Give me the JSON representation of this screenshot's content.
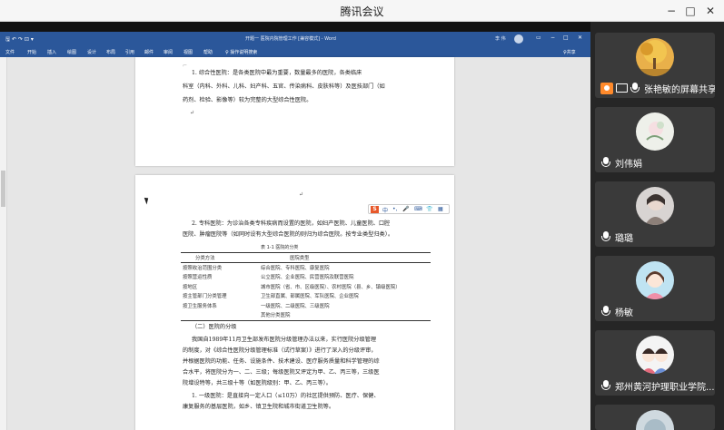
{
  "window": {
    "title": "腾讯会议",
    "controls": [
      "−",
      "□",
      "✕"
    ]
  },
  "word": {
    "doc_title": "开题一 医院内院管理工作 [兼容模式] - Word",
    "user": "李 伟",
    "quick_access": "🖫 ↶ ↷ ⊡ ▾",
    "menu": [
      "文件",
      "开始",
      "插入",
      "绘图",
      "设计",
      "布局",
      "引用",
      "邮件",
      "审阅",
      "视图",
      "帮助",
      "♀ 操作说明搜索",
      "♀共享"
    ],
    "page1": [
      "1. 综合性医院：是各类医院中最为重要，数量最多的医院，各类临床",
      "科室（内科、外科、儿科、妇产科、五官、传染病科、皮肤科等）及医技部门（如",
      "药剂、检验、影像等）较为完整的大型综合性医院。"
    ],
    "page2": {
      "intro": [
        "2. 专科医院：为诊治各类专科疾病而设置的医院，如妇产医院、儿童医院、口腔",
        "医院、肿瘤医院等（如同时设有大型综合医院的则归为综合医院。按专业类型归类）。"
      ],
      "table_caption": "表 1-1 医院的分类",
      "table_headers": [
        "分类方法",
        "医院类型"
      ],
      "table_rows": [
        [
          "按照收治范围分类",
          "综合医院、专科医院、康复医院"
        ],
        [
          "按照营运性质",
          "公立医院、企业医院、民营医院及联营医院"
        ],
        [
          "按地区",
          "城市医院（省、市、区级医院）、农村医院（县、乡、镇级医院）"
        ],
        [
          "按主管部门分类管理",
          "卫生部直属、部属医院、军队医院、企业医院"
        ],
        [
          "按卫生服务体系",
          "一级医院、二级医院、三级医院"
        ],
        [
          "",
          "其他分类医院"
        ]
      ],
      "section": "（二）医院的分级",
      "body": [
        "我国自1989年11月卫生部发布医院分级管理办法以来，实行医院分级管理",
        "的制度，对《综合性医院分级管理标准（试行草案）》进行了深入的分级评审，",
        "并根据医院的功能、任务、设施条件、技术建设、医疗服务质量和科学管理的综",
        "合水平，将医院分为一、二、三级；每级医院又评定为甲、乙、丙三等，三级医",
        "院增设特等，共三级十等（如医院级别：甲、乙、丙三等）。",
        "1. 一级医院：是直接向一定人口（≤10万）的社区提供预防、医疗、保健、",
        "康复服务的基层医院，如乡、镇卫生院和城市街道卫生院等。"
      ]
    },
    "floatbar_icons": [
      "S",
      "中",
      "•,",
      "🎤",
      "⌨",
      "👕",
      "▦"
    ]
  },
  "participants": [
    {
      "name": "张艳敏的屏幕共享",
      "avatar": "autumn-tree",
      "sharing": true,
      "highlight": "#f4b400"
    },
    {
      "name": "刘伟娟",
      "avatar": "flower-sketch",
      "highlight": "#f4b400"
    },
    {
      "name": "璐璐",
      "avatar": "portrait",
      "highlight": "#f4b400"
    },
    {
      "name": "杨敏",
      "avatar": "cartoon-girl",
      "highlight": "#f4b400"
    },
    {
      "name": "郑州黄河护理职业学院...",
      "avatar": "cartoon-couple",
      "highlight": "#f4b400"
    }
  ],
  "colors": {
    "word_blue": "#2b579a",
    "panel_bg": "#262626",
    "tile_bg": "#3a3a3a"
  }
}
